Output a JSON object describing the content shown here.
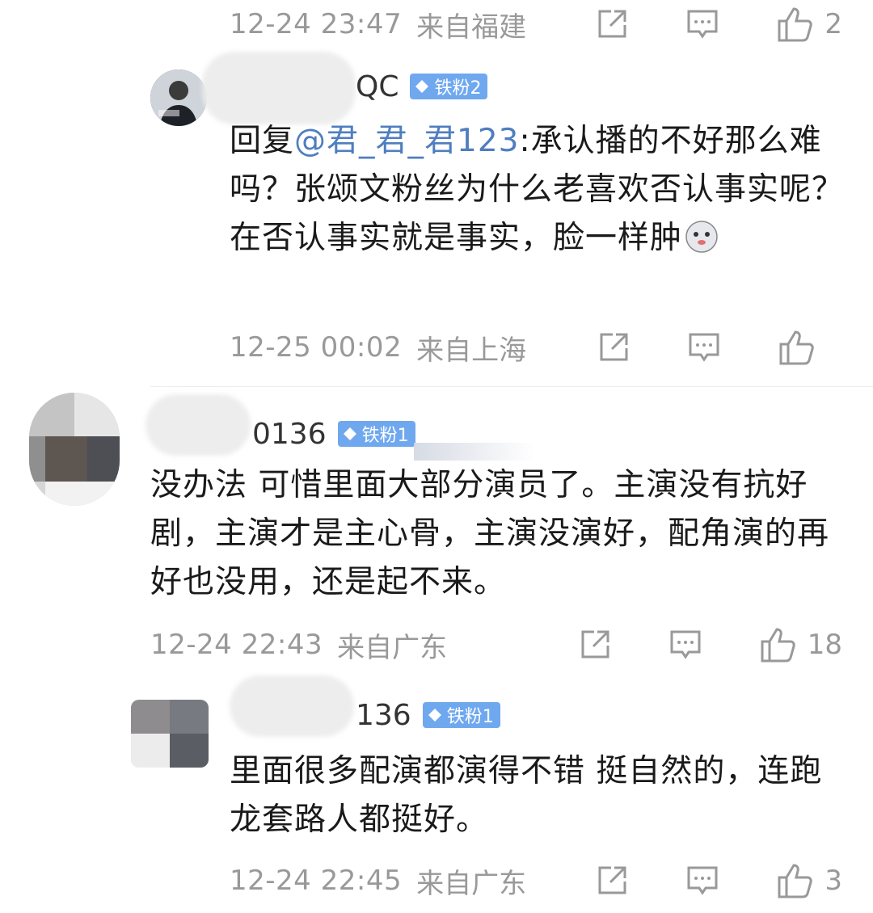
{
  "comments": [
    {
      "id": "c0",
      "time": "12-24 23:47",
      "location": "来自福建",
      "likes": "2"
    },
    {
      "id": "c1",
      "username_suffix": "QC",
      "badge": "铁粉2",
      "reply_prefix": "回复",
      "mention": "@君_君_君123",
      "text": ":承认播的不好那么难吗？张颂文粉丝为什么老喜欢否认事实呢？在否认事实就是事实，脸一样肿",
      "emoji": "doge-emoji",
      "time": "12-25 00:02",
      "location": "来自上海",
      "likes": ""
    },
    {
      "id": "c2",
      "username_suffix": "0136",
      "badge": "铁粉1",
      "text": "没办法 可惜里面大部分演员了。主演没有抗好剧，主演才是主心骨，主演没演好，配角演的再好也没用，还是起不来。",
      "time": "12-24 22:43",
      "location": "来自广东",
      "likes": "18"
    },
    {
      "id": "c3",
      "username_suffix": "136",
      "badge": "铁粉1",
      "text": "里面很多配演都演得不错 挺自然的，连跑龙套路人都挺好。",
      "time": "12-24 22:45",
      "location": "来自广东",
      "likes": "3"
    }
  ],
  "icons": {
    "share": "share-icon",
    "reply": "comment-icon",
    "like": "thumbs-up-icon",
    "badge": "diamond-icon"
  },
  "colors": {
    "meta_gray": "#999999",
    "mention_blue": "#4f7ec0",
    "badge_blue": "#6fa8ef"
  }
}
